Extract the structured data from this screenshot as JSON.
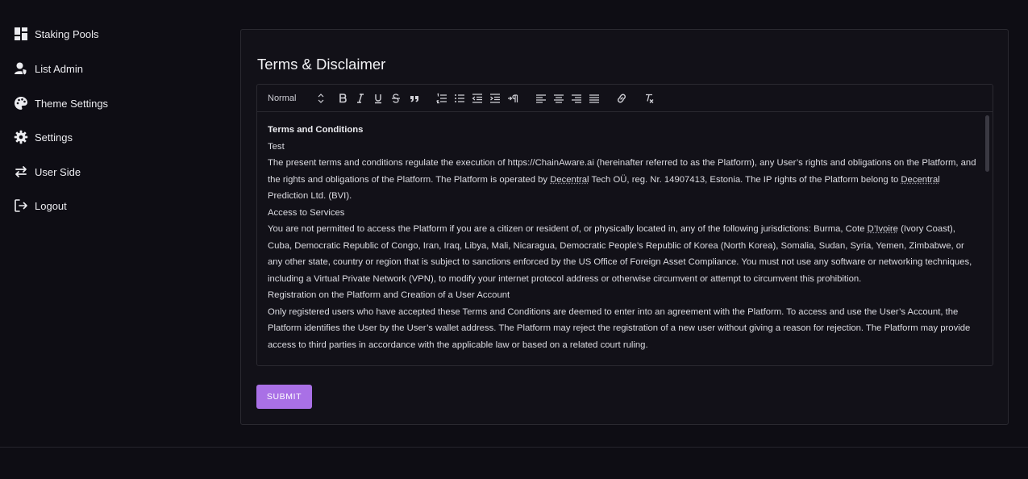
{
  "sidebar": {
    "items": [
      {
        "label": "Staking Pools",
        "icon": "dashboard-icon"
      },
      {
        "label": "List Admin",
        "icon": "user-shield-icon"
      },
      {
        "label": "Theme Settings",
        "icon": "palette-icon"
      },
      {
        "label": "Settings",
        "icon": "gear-icon"
      },
      {
        "label": "User Side",
        "icon": "swap-arrows-icon"
      },
      {
        "label": "Logout",
        "icon": "logout-icon"
      }
    ]
  },
  "card": {
    "title": "Terms & Disclaimer",
    "submit_label": "SUBMIT"
  },
  "editor": {
    "format_select": "Normal",
    "toolbar_icons": [
      "bold-icon",
      "italic-icon",
      "underline-icon",
      "strike-icon",
      "blockquote-icon",
      "ordered-list-icon",
      "bullet-list-icon",
      "indent-decrease-icon",
      "indent-increase-icon",
      "text-direction-icon",
      "align-left-icon",
      "align-center-icon",
      "align-right-icon",
      "align-justify-icon",
      "link-icon",
      "clear-format-icon"
    ],
    "content": {
      "heading": "Terms and Conditions",
      "p1": "Test",
      "p2a": "The present terms and conditions regulate the execution of https://ChainAware.ai (hereinafter referred to as the Platform), any User’s rights and obligations on the Platform, and the rights and obligations of the Platform. The Platform is operated by ",
      "p2b": "Decentral",
      "p2c": " Tech OÜ, reg. Nr. 14907413, Estonia. The IP rights of the Platform belong to ",
      "p2d": "Decentral",
      "p2e": " Prediction Ltd. (BVI).",
      "p3": "Access to Services",
      "p4a": "You are not permitted to access the Platform if you are a citizen or resident of, or physically located in, any of the following jurisdictions: Burma, Cote ",
      "p4b": "D’Ivoire",
      "p4c": " (Ivory Coast), Cuba, Democratic Republic of Congo, Iran, Iraq, Libya, Mali, Nicaragua, Democratic People’s Republic of Korea (North Korea), Somalia, Sudan, Syria, Yemen, Zimbabwe, or any other state, country or region that is subject to sanctions enforced by the US Office of Foreign Asset Compliance. You must not use any software or networking techniques, including a Virtual Private Network (VPN), to modify your internet protocol address or otherwise circumvent or attempt to circumvent this prohibition.",
      "p5": "Registration on the Platform and Creation of a User Account",
      "p6": "Only registered users who have accepted these Terms and Conditions are deemed to enter into an agreement with the Platform. To access and use the User’s Account, the Platform identifies the User by the User’s wallet address. The Platform may reject the registration of a new user without giving a reason for rejection. The Platform may provide access to third parties in accordance with the applicable law or based on a related court ruling."
    }
  },
  "colors": {
    "background": "#0e0d14",
    "card": "#121118",
    "accent": "#a970e6"
  }
}
